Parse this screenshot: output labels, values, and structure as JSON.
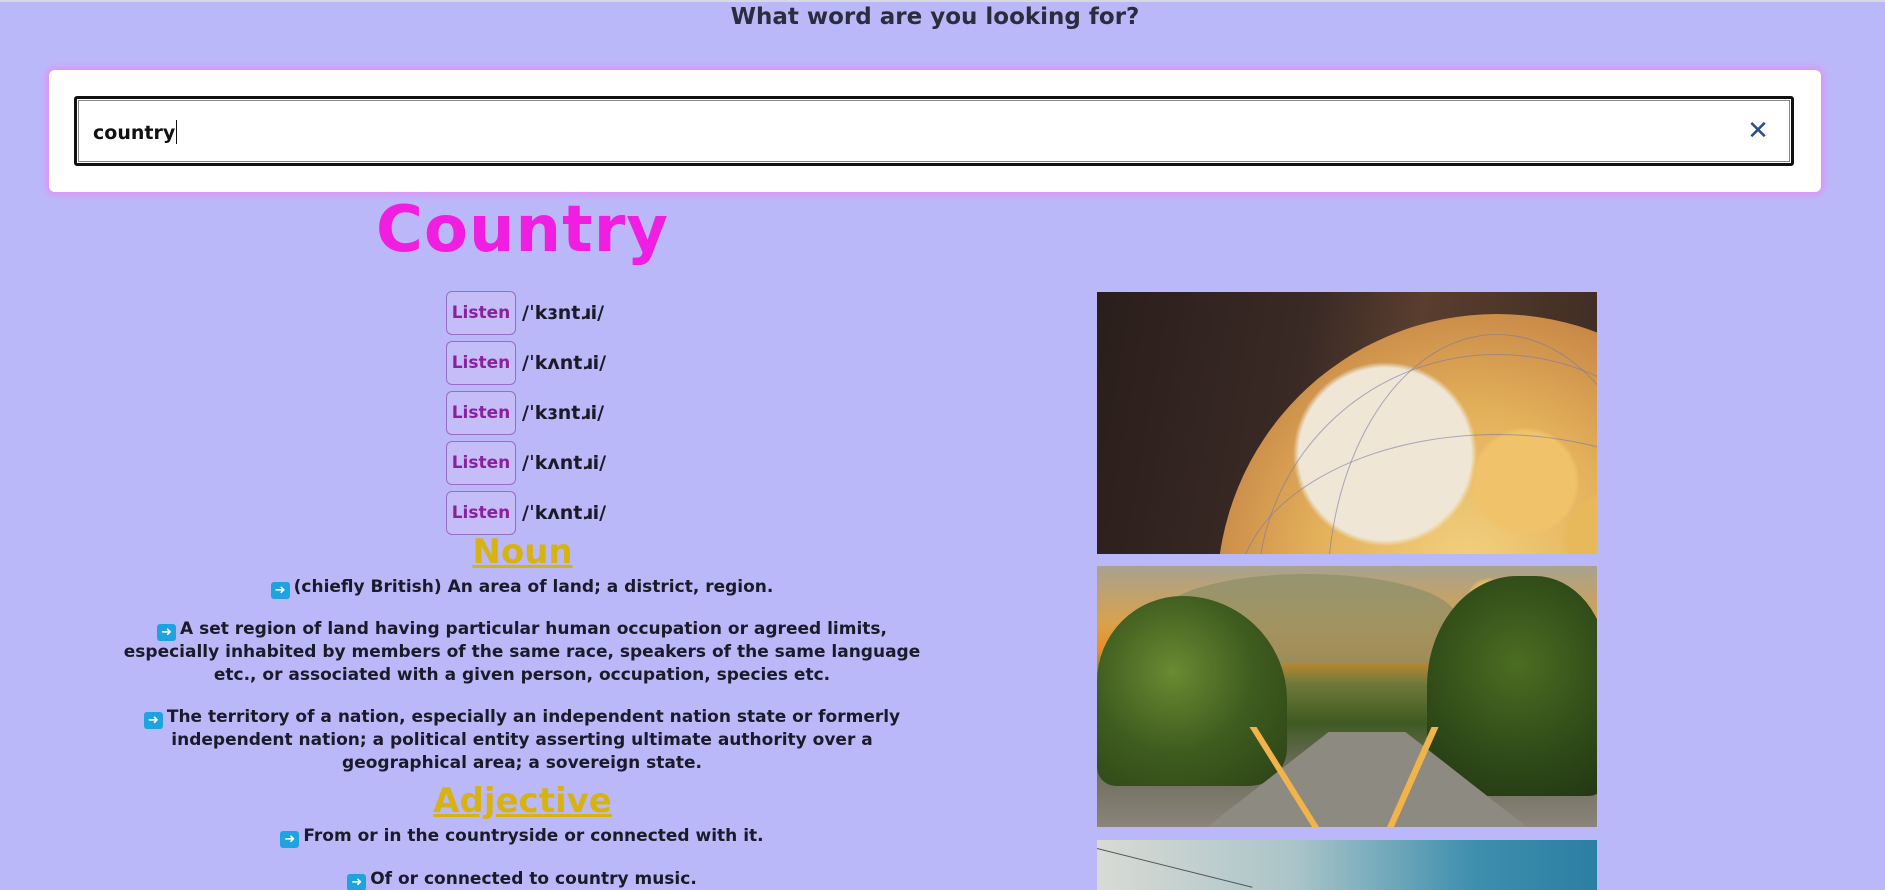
{
  "header": {
    "prompt": "What word are you looking for?"
  },
  "search": {
    "value": "country",
    "clear_icon": "close-icon"
  },
  "word": {
    "title": "Country"
  },
  "pronunciations": [
    {
      "button_label": "Listen",
      "ipa": "/ˈkɜntɹi/"
    },
    {
      "button_label": "Listen",
      "ipa": "/ˈkʌntɹi/"
    },
    {
      "button_label": "Listen",
      "ipa": "/ˈkɜntɹi/"
    },
    {
      "button_label": "Listen",
      "ipa": "/ˈkʌntɹi/"
    },
    {
      "button_label": "Listen",
      "ipa": "/ˈkʌntɹi/"
    }
  ],
  "meanings": {
    "noun": {
      "heading": "Noun",
      "definitions": [
        "(chiefly British) An area of land; a district, region.",
        "A set region of land having particular human occupation or agreed limits, especially inhabited by members of the same race, speakers of the same language etc., or associated with a given person, occupation, species etc.",
        "The territory of a nation, especially an independent nation state or formerly independent nation; a political entity asserting ultimate authority over a geographical area; a sovereign state."
      ]
    },
    "adjective": {
      "heading": "Adjective",
      "definitions": [
        "From or in the countryside or connected with it.",
        "Of or connected to country music."
      ]
    }
  },
  "icons": {
    "definition_bullet": "right-arrow-icon"
  },
  "images": [
    {
      "subject": "globe"
    },
    {
      "subject": "railway-sunset"
    },
    {
      "subject": "sky"
    }
  ],
  "colors": {
    "background": "#bbb8fa",
    "title": "#f01ee0",
    "part_of_speech": "#d7b312",
    "listen_text": "#8a1fa0",
    "bullet": "#1fa2e0"
  }
}
